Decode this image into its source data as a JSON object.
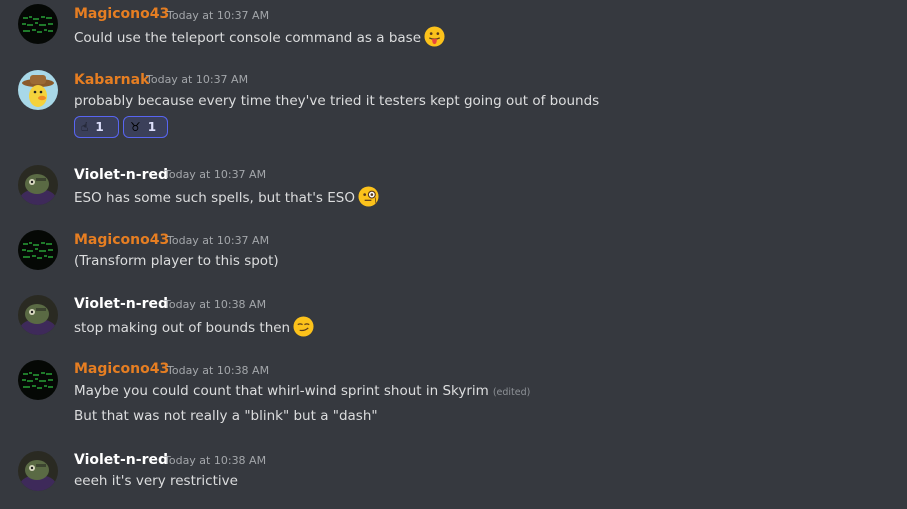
{
  "messages": [
    {
      "author": "Magicono43",
      "timestamp": "Today at 10:37 AM",
      "lines": [
        "Could use the teleport console command as a base"
      ],
      "emoji": "tongue-out-emoji"
    },
    {
      "author": "Kabarnak",
      "timestamp": "Today at 10:37 AM",
      "lines": [
        "probably because every time they've tried it testers kept going out of bounds"
      ],
      "reactions": [
        {
          "emoji": "☝",
          "icon": "pointing-up-emoji",
          "count": "1"
        },
        {
          "emoji": "♉",
          "icon": "ram-emoji",
          "count": "1"
        }
      ]
    },
    {
      "author": "Violet-n-red",
      "timestamp": "Today at 10:37 AM",
      "lines": [
        "ESO has some such spells, but that's ESO"
      ],
      "emoji": "monocle-emoji"
    },
    {
      "author": "Magicono43",
      "timestamp": "Today at 10:37 AM",
      "lines": [
        "(Transform player to this spot)"
      ]
    },
    {
      "author": "Violet-n-red",
      "timestamp": "Today at 10:38 AM",
      "lines": [
        "stop making out of bounds then"
      ],
      "emoji": "smirk-emoji"
    },
    {
      "author": "Magicono43",
      "timestamp": "Today at 10:38 AM",
      "lines": [
        "Maybe you could count that whirl-wind sprint shout in Skyrim",
        "But that was not really a \"blink\" but a \"dash\""
      ],
      "edited": "(edited)"
    },
    {
      "author": "Violet-n-red",
      "timestamp": "Today at 10:38 AM",
      "lines": [
        "eeeh it's very restrictive"
      ]
    }
  ],
  "colors": {
    "background": "#36393f",
    "magicono_name": "#e67e22",
    "kabarnak_name": "#e67e22",
    "violet_name": "#ffffff",
    "reaction_border": "#5865f2"
  }
}
